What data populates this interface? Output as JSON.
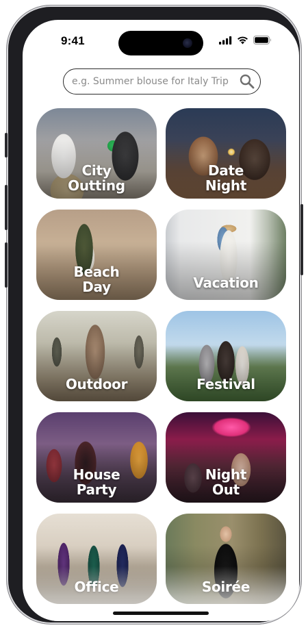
{
  "status_bar": {
    "time": "9:41",
    "icons": [
      "cellular-signal-icon",
      "wifi-icon",
      "battery-icon"
    ]
  },
  "search": {
    "placeholder": "e.g. Summer blouse for Italy Trip",
    "value": "",
    "icon": "search-icon"
  },
  "categories": [
    {
      "label": "City\nOutting"
    },
    {
      "label": "Date\nNight"
    },
    {
      "label": "Beach\nDay"
    },
    {
      "label": "Vacation"
    },
    {
      "label": "Outdoor"
    },
    {
      "label": "Festival"
    },
    {
      "label": "House\nParty"
    },
    {
      "label": "Night\nOut"
    },
    {
      "label": "Office"
    },
    {
      "label": "Soirée"
    }
  ],
  "colors": {
    "frame": "#1e1e22",
    "screen_background": "#ffffff",
    "label_text": "#ffffff",
    "search_border": "#2b2b2b",
    "placeholder_text": "#8a8a8a"
  }
}
